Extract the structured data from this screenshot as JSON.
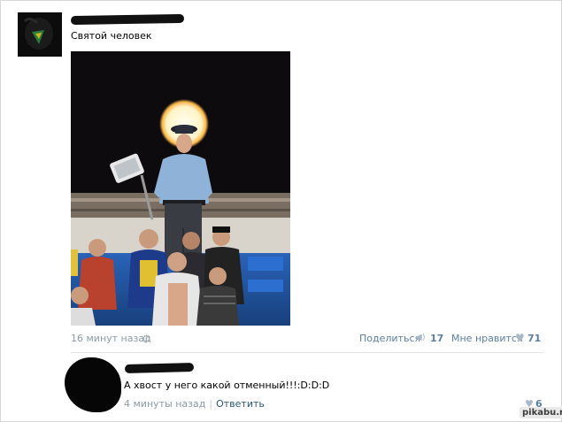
{
  "post": {
    "text": "Святой человек",
    "time": "16 минут назад",
    "share_label": "Поделиться",
    "share_count": "17",
    "like_label": "Мне нравится",
    "like_count": "71"
  },
  "comment": {
    "text": "А хвост у него какой отменный!!!:D:D:D",
    "time": "4 минуты назад",
    "separator": "|",
    "reply_label": "Ответить",
    "like_count": "6"
  },
  "watermark": "pikabu.ru",
  "icons": {
    "gear": "gear-icon",
    "share": "megaphone-icon",
    "heart": "heart-icon"
  },
  "colors": {
    "link": "#2b587a",
    "meta": "#8c9aa8",
    "count": "#5b7ea4"
  }
}
